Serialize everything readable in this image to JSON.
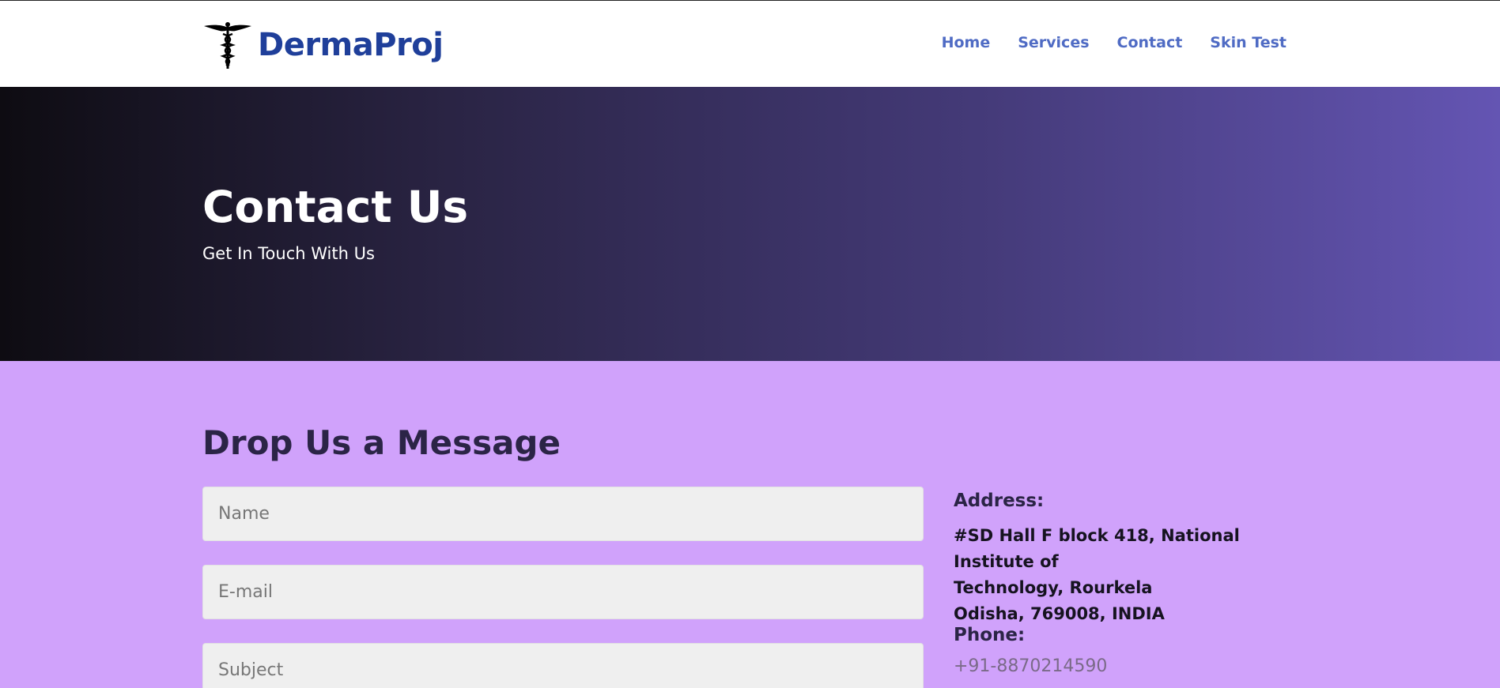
{
  "brand": {
    "name": "DermaProj",
    "logo_icon": "caduceus-icon"
  },
  "nav": {
    "items": [
      {
        "label": "Home"
      },
      {
        "label": "Services"
      },
      {
        "label": "Contact"
      },
      {
        "label": "Skin Test"
      }
    ]
  },
  "hero": {
    "title": "Contact Us",
    "subtitle": "Get In Touch With Us",
    "gradient_colors": [
      "#0e0c12",
      "#2a2444",
      "#443a78",
      "#6455b3"
    ]
  },
  "contact": {
    "heading": "Drop Us a Message",
    "background": "#d0a2fb",
    "form": {
      "name_placeholder": "Name",
      "email_placeholder": "E-mail",
      "subject_placeholder": "Subject"
    },
    "info": {
      "address_label": "Address:",
      "address_line1": "#SD Hall F block 418, National Institute of",
      "address_line2": "Technology, Rourkela",
      "address_line3": "Odisha, 769008, INDIA",
      "phone_label": "Phone:",
      "phone_value": "+91-8870214590"
    }
  },
  "colors": {
    "brand": "#1f3f9a",
    "nav_link": "#4f6bc4",
    "heading": "#2b2446"
  }
}
